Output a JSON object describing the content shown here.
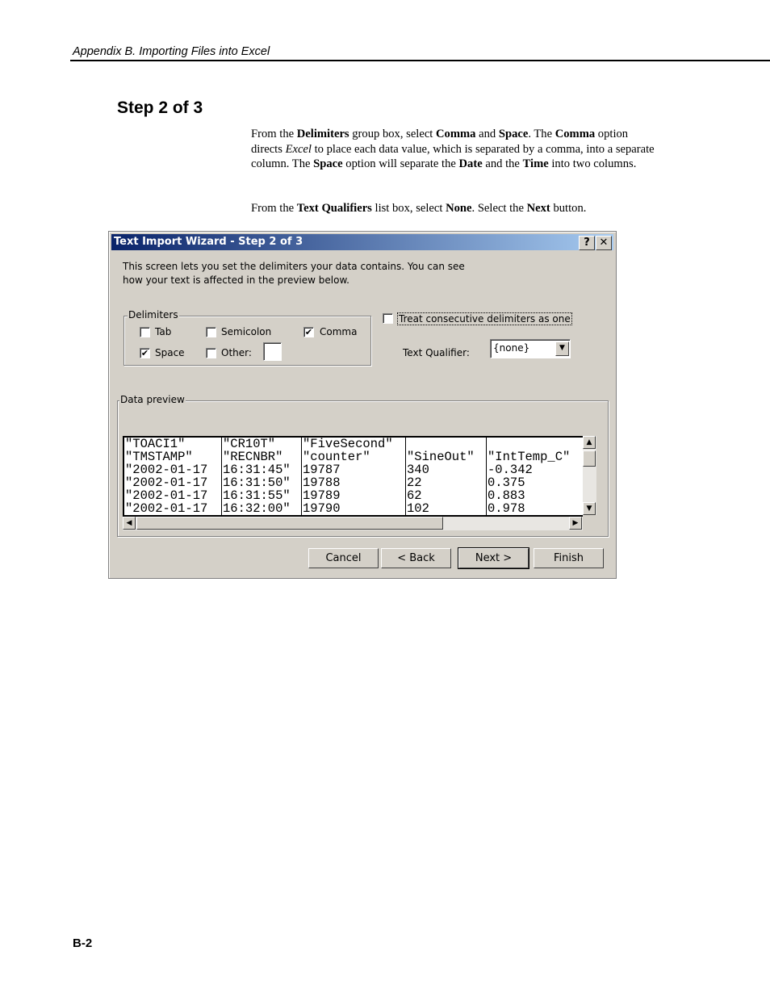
{
  "header": {
    "running_title": "Appendix B.  Importing Files into Excel"
  },
  "section_title": "Step 2 of 3",
  "paragraphs": [
    [
      {
        "t": "From the "
      },
      {
        "t": "Delimiters",
        "b": true
      },
      {
        "t": " group box, select "
      },
      {
        "t": "Comma",
        "b": true
      },
      {
        "t": " and "
      },
      {
        "t": "Space",
        "b": true
      },
      {
        "t": ".  The "
      },
      {
        "t": "Comma",
        "b": true
      },
      {
        "t": " option directs "
      },
      {
        "t": "Excel",
        "i": true
      },
      {
        "t": " to place each data value, which is separated by a comma, into a separate column.  The "
      },
      {
        "t": "Space",
        "b": true
      },
      {
        "t": " option will separate the "
      },
      {
        "t": "Date",
        "b": true
      },
      {
        "t": " and the "
      },
      {
        "t": "Time",
        "b": true
      },
      {
        "t": " into two columns."
      }
    ],
    [
      {
        "t": "From the "
      },
      {
        "t": "Text Qualifiers",
        "b": true
      },
      {
        "t": " list box, select "
      },
      {
        "t": "None",
        "b": true
      },
      {
        "t": ".  Select the "
      },
      {
        "t": "Next",
        "b": true
      },
      {
        "t": " button."
      }
    ]
  ],
  "dialog": {
    "title": "Text Import Wizard - Step 2 of 3",
    "help_label": "?",
    "close_label": "✕",
    "intro_line1": "This screen lets you set the delimiters your data contains.  You can see",
    "intro_line2": "how your text is affected in the preview below.",
    "delimiters_label": "Delimiters",
    "tab": {
      "label": "Tab",
      "checked": false
    },
    "semicolon": {
      "label": "Semicolon",
      "checked": false
    },
    "comma": {
      "label": "Comma",
      "checked": true
    },
    "space": {
      "label": "Space",
      "checked": true
    },
    "other": {
      "label": "Other:",
      "checked": false,
      "value": ""
    },
    "treat_consecutive": {
      "label": "Treat consecutive delimiters as one",
      "checked": false
    },
    "text_qualifier_label": "Text Qualifier:",
    "text_qualifier_value": "{none}",
    "data_preview_label": "Data preview",
    "preview_columns": [
      [
        "\"TOACI1\"",
        "\"TMSTAMP\"",
        "\"2002-01-17",
        "\"2002-01-17",
        "\"2002-01-17",
        "\"2002-01-17"
      ],
      [
        "\"CR10T\"",
        "\"RECNBR\"",
        "16:31:45\"",
        "16:31:50\"",
        "16:31:55\"",
        "16:32:00\""
      ],
      [
        "\"FiveSecond\"",
        "\"counter\"",
        "19787",
        "19788",
        "19789",
        "19790"
      ],
      [
        "",
        "\"SineOut\"",
        "340",
        "22",
        "62",
        "102"
      ],
      [
        "",
        "\"IntTemp_C\"",
        "-0.342",
        "0.375",
        "0.883",
        "0.978"
      ]
    ],
    "buttons": {
      "cancel": "Cancel",
      "back": "< Back",
      "next": "Next >",
      "finish": "Finish"
    }
  },
  "footer": {
    "page_number": "B-2"
  }
}
